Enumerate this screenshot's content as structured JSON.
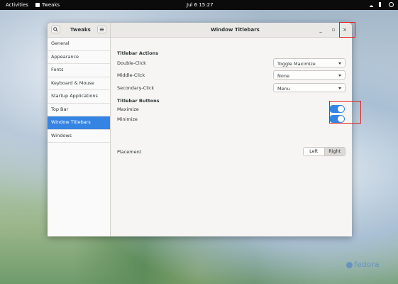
{
  "topbar": {
    "activities": "Activities",
    "app_name": "Tweaks",
    "clock": "Jul 6  15:27"
  },
  "window": {
    "sidebar_title": "Tweaks",
    "title": "Window Titlebars",
    "controls": {
      "minimize": "_",
      "maximize": "▫",
      "close": "×"
    }
  },
  "sidebar": {
    "items": [
      {
        "label": "General"
      },
      {
        "label": "Appearance"
      },
      {
        "label": "Fonts"
      },
      {
        "label": "Keyboard & Mouse"
      },
      {
        "label": "Startup Applications"
      },
      {
        "label": "Top Bar"
      },
      {
        "label": "Window Titlebars",
        "active": true
      },
      {
        "label": "Windows"
      }
    ]
  },
  "content": {
    "actions_title": "Titlebar Actions",
    "double_click": {
      "label": "Double-Click",
      "value": "Toggle Maximize"
    },
    "middle_click": {
      "label": "Middle-Click",
      "value": "None"
    },
    "secondary_click": {
      "label": "Secondary-Click",
      "value": "Menu"
    },
    "buttons_title": "Titlebar Buttons",
    "maximize": {
      "label": "Maximize",
      "on": true
    },
    "minimize": {
      "label": "Minimize",
      "on": true
    },
    "placement": {
      "label": "Placement",
      "options": [
        "Left",
        "Right"
      ],
      "selected": "Right"
    }
  },
  "branding": {
    "text": "fedora"
  },
  "colors": {
    "accent": "#3584e4",
    "highlight_box": "#e02020"
  }
}
